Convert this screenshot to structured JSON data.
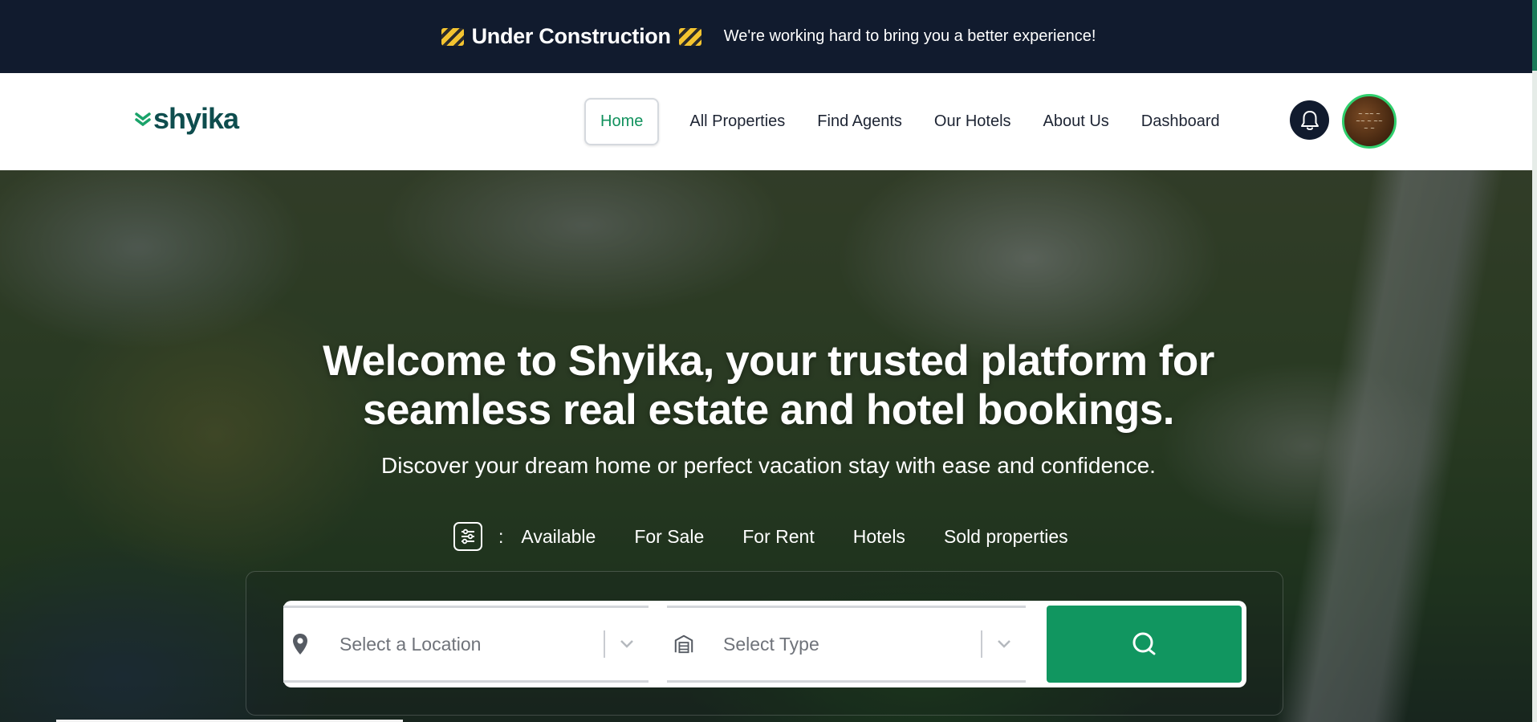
{
  "banner": {
    "title": "Under Construction",
    "message": "We're working hard to bring you a better experience!"
  },
  "header": {
    "logo_text": "shyika",
    "nav": [
      {
        "label": "Home",
        "active": true
      },
      {
        "label": "All Properties"
      },
      {
        "label": "Find Agents"
      },
      {
        "label": "Our Hotels"
      },
      {
        "label": "About Us"
      },
      {
        "label": "Dashboard"
      }
    ],
    "notification_icon": "bell-icon",
    "avatar_icon": "user-avatar"
  },
  "hero": {
    "headline_line1": "Welcome to Shyika, your trusted platform for",
    "headline_line2": "seamless real estate and hotel bookings.",
    "subheadline": "Discover your dream home or perfect vacation stay with ease and confidence.",
    "filter_separator": ":",
    "filters": [
      "Available",
      "For Sale",
      "For Rent",
      "Hotels",
      "Sold properties"
    ]
  },
  "search": {
    "location_placeholder": "Select a Location",
    "type_placeholder": "Select Type"
  },
  "colors": {
    "brand_green": "#119660",
    "banner_bg": "#111b2e",
    "logo": "#0e4d4e"
  }
}
